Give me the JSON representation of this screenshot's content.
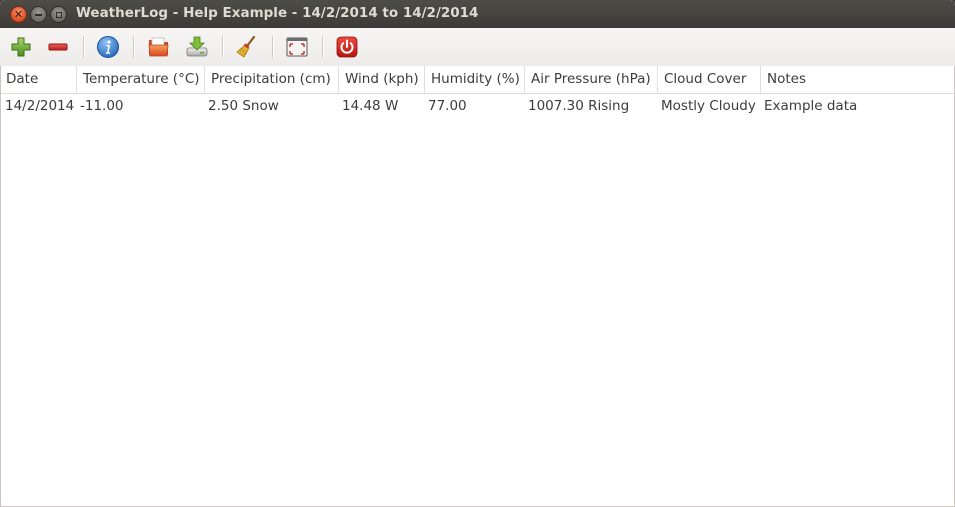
{
  "window": {
    "title": "WeatherLog - Help Example - 14/2/2014 to 14/2/2014"
  },
  "toolbar": {
    "buttons": [
      {
        "name": "add",
        "icon": "plus-icon",
        "color": "#6aa82f"
      },
      {
        "name": "remove",
        "icon": "minus-icon",
        "color": "#d62d2d"
      },
      {
        "name": "info",
        "icon": "info-icon",
        "color": "#2a6fc7"
      },
      {
        "name": "open",
        "icon": "folder-open-icon",
        "color": "#e8753a"
      },
      {
        "name": "save",
        "icon": "download-icon",
        "color": "#7fae3c"
      },
      {
        "name": "clear",
        "icon": "broom-icon",
        "color": "#d9a521"
      },
      {
        "name": "fullscreen",
        "icon": "fullscreen-icon",
        "color": "#c03a2b"
      },
      {
        "name": "quit",
        "icon": "power-icon",
        "color": "#d0231c"
      }
    ]
  },
  "table": {
    "columns": [
      "Date",
      "Temperature (°C)",
      "Precipitation (cm)",
      "Wind (kph)",
      "Humidity (%)",
      "Air Pressure (hPa)",
      "Cloud Cover",
      "Notes"
    ],
    "rows": [
      [
        "14/2/2014",
        "-11.00",
        "2.50 Snow",
        "14.48 W",
        "77.00",
        "1007.30 Rising",
        "Mostly Cloudy",
        "Example data"
      ]
    ]
  }
}
